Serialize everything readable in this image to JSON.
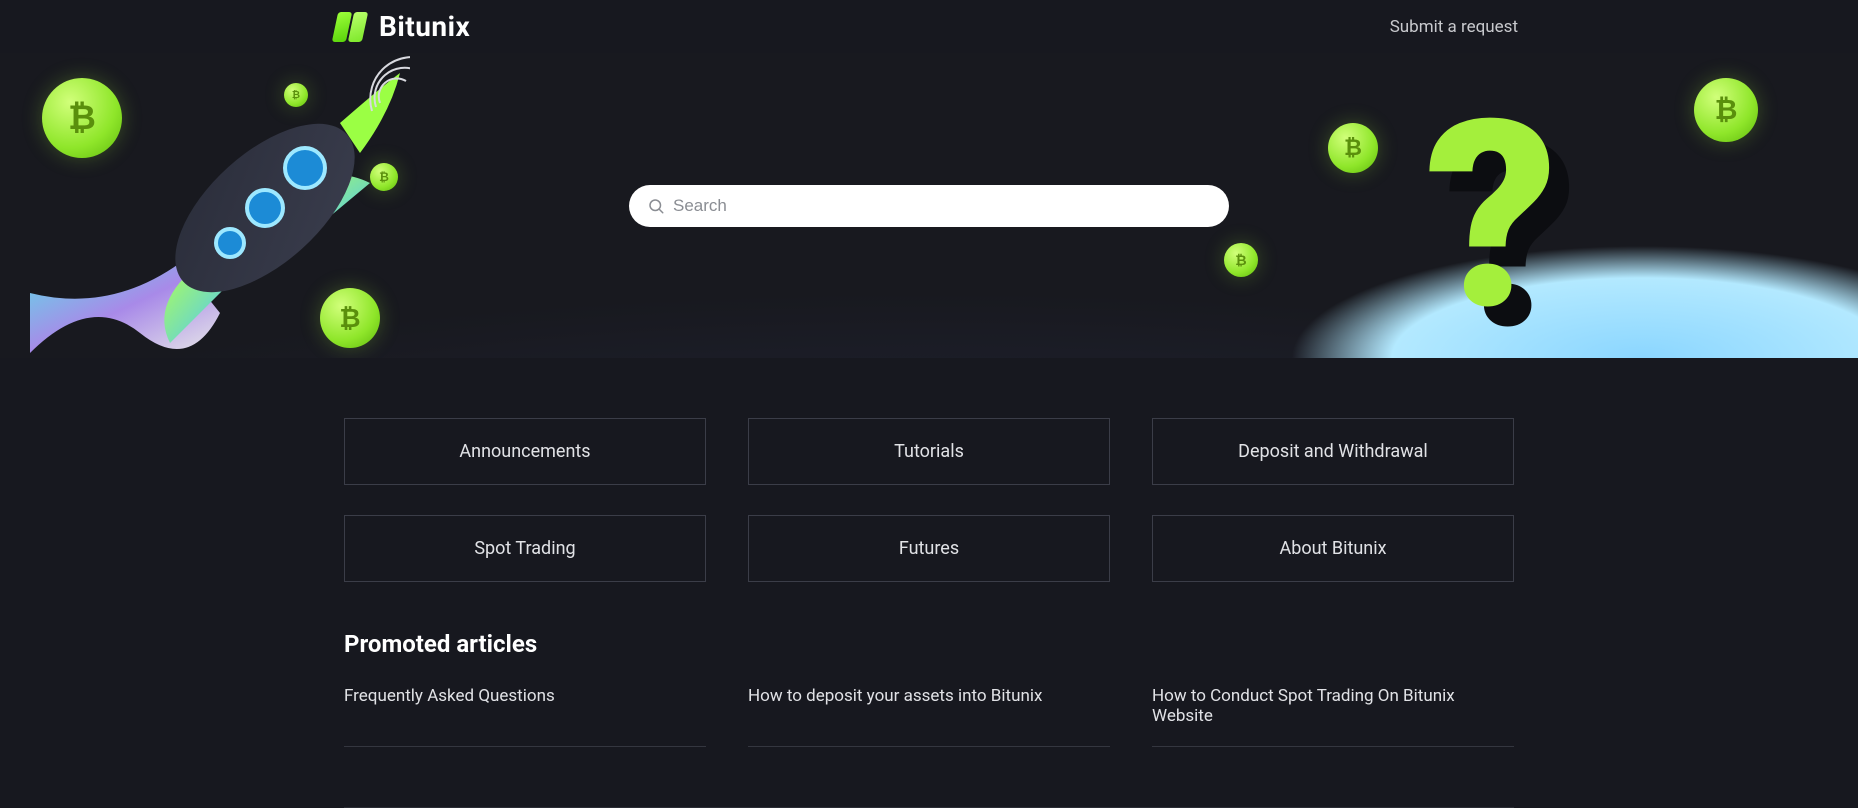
{
  "brand": {
    "name": "Bitunix"
  },
  "header": {
    "submit_label": "Submit a request"
  },
  "search": {
    "placeholder": "Search"
  },
  "categories": [
    {
      "label": "Announcements"
    },
    {
      "label": "Tutorials"
    },
    {
      "label": "Deposit and Withdrawal"
    },
    {
      "label": "Spot Trading"
    },
    {
      "label": "Futures"
    },
    {
      "label": "About Bitunix"
    }
  ],
  "promoted": {
    "title": "Promoted articles",
    "articles": [
      {
        "title": "Frequently Asked Questions"
      },
      {
        "title": "How to deposit your assets into Bitunix"
      },
      {
        "title": "How to Conduct Spot Trading On Bitunix Website"
      }
    ]
  }
}
